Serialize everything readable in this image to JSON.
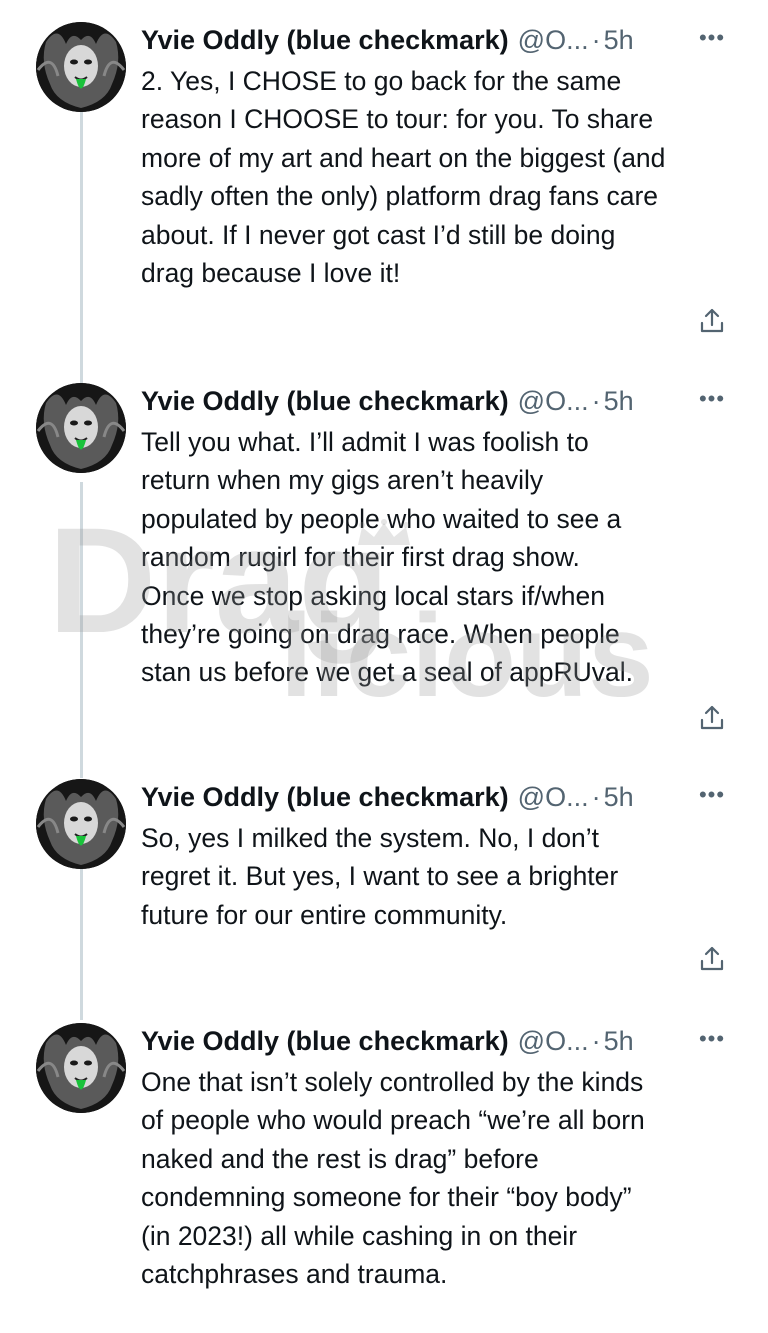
{
  "tweets": [
    {
      "name": "Yvie Oddly (blue checkmark)",
      "handle": "@O...",
      "dot": "·",
      "time": "5h",
      "more_icon": "•••",
      "text": "2. Yes, I CHOSE to go back for the same\nreason I CHOOSE to tour: for you. To share\nmore of my art and heart on the biggest (and\nsadly often the only) platform drag fans care\nabout. If I never got cast I’d still be doing\ndrag because I love it!"
    },
    {
      "name": "Yvie Oddly (blue checkmark)",
      "handle": "@O...",
      "dot": "·",
      "time": "5h",
      "more_icon": "•••",
      "text": "Tell you what. I’ll admit I was foolish to\nreturn when my gigs aren’t heavily\npopulated by people who waited to see a\nrandom rugirl for their first drag show.\nOnce we stop asking local stars if/when\nthey’re going on drag race. When people\nstan us before we get a seal of appRUval."
    },
    {
      "name": "Yvie Oddly (blue checkmark)",
      "handle": "@O...",
      "dot": "·",
      "time": "5h",
      "more_icon": "•••",
      "text": "So, yes I milked the system. No, I don’t\nregret it. But yes, I want to see a brighter\nfuture for our entire community."
    },
    {
      "name": "Yvie Oddly (blue checkmark)",
      "handle": "@O...",
      "dot": "·",
      "time": "5h",
      "more_icon": "•••",
      "text": "One that isn’t solely controlled by the kinds\nof people who would preach “we’re all born\nnaked and the rest is drag” before\ncondemning someone for their “boy body”\n(in 2023!) all while cashing in on their\ncatchphrases and trauma."
    }
  ],
  "watermark": {
    "line1": "Drag",
    "line2": "licious",
    "icon": "crown-icon"
  },
  "colors": {
    "text": "#0f1419",
    "secondary": "#536471",
    "thread_line": "#cfd9de"
  }
}
